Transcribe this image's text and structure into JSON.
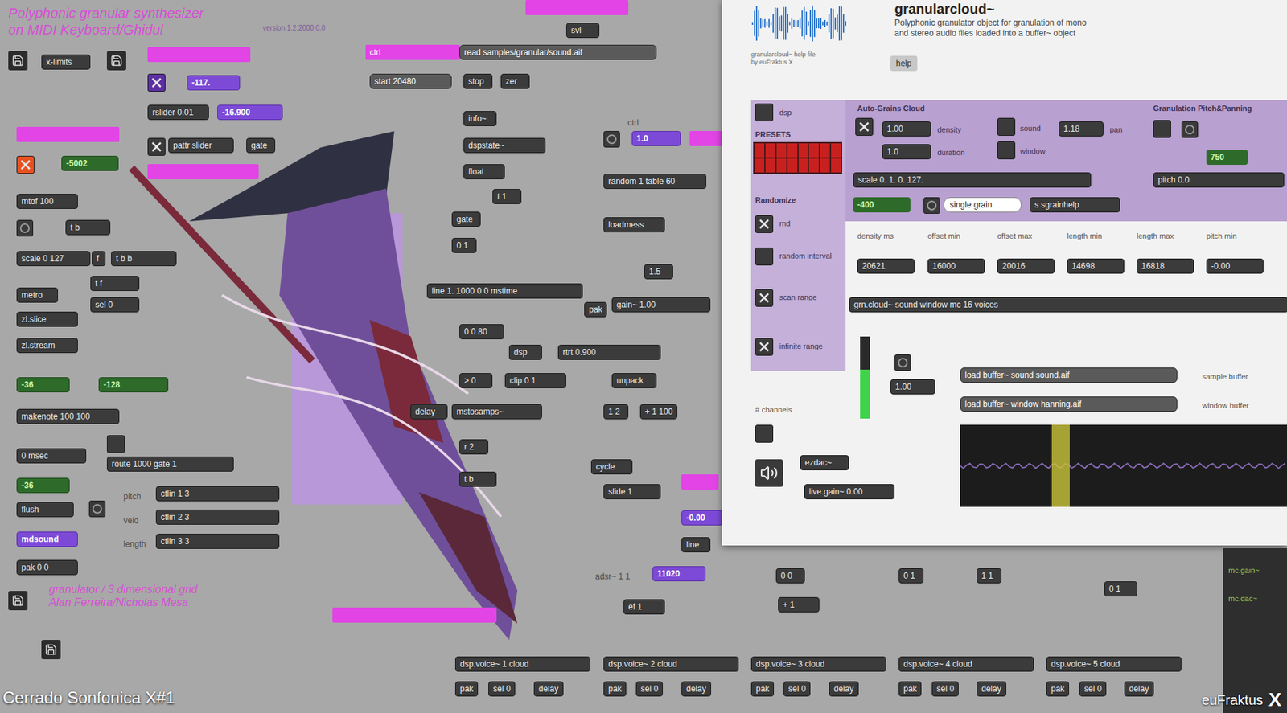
{
  "patch": {
    "title": [
      "Polyphonic granular synthesizer",
      "on MIDI Keyboard/Ghidul"
    ],
    "version": "version 1.2.2000.0.0",
    "footnote": [
      "granulator / 3 dimensional grid",
      "Alan Ferreira/Nicholas Mesa"
    ],
    "nodes": [
      {
        "kind": "object",
        "text": "x-limits"
      },
      {
        "kind": "pink",
        "text": ""
      },
      {
        "kind": "toggle",
        "checked": true,
        "color": "#5b2fa0"
      },
      {
        "kind": "purple",
        "text": "-117."
      },
      {
        "kind": "object",
        "text": "rslider 0.01"
      },
      {
        "kind": "purple",
        "text": "-16.900"
      },
      {
        "kind": "toggle",
        "checked": true,
        "color": "#3a3a3a"
      },
      {
        "kind": "object",
        "text": "pattr slider"
      },
      {
        "kind": "object",
        "text": "gate"
      },
      {
        "kind": "pink",
        "text": ""
      },
      {
        "kind": "pink",
        "text": ""
      },
      {
        "kind": "toggle",
        "checked": true,
        "color": "#e8501f"
      },
      {
        "kind": "number",
        "text": "-5002"
      },
      {
        "kind": "object",
        "text": "mtof 100"
      },
      {
        "kind": "button"
      },
      {
        "kind": "object",
        "text": "t b"
      },
      {
        "kind": "object",
        "text": "scale 0 127"
      },
      {
        "kind": "object",
        "text": "f"
      },
      {
        "kind": "object",
        "text": "t b b"
      },
      {
        "kind": "object",
        "text": "t f"
      },
      {
        "kind": "object",
        "text": "sel 0"
      },
      {
        "kind": "object",
        "text": "metro"
      },
      {
        "kind": "object",
        "text": "zl.slice"
      },
      {
        "kind": "object",
        "text": "zl.stream"
      },
      {
        "kind": "number",
        "text": "-36"
      },
      {
        "kind": "number",
        "text": "-128"
      },
      {
        "kind": "object",
        "text": "makenote 100 100"
      },
      {
        "kind": "toggle",
        "checked": false,
        "color": "#3a3a3a"
      },
      {
        "kind": "object",
        "text": "0 msec"
      },
      {
        "kind": "object",
        "text": "route 1000 gate 1"
      },
      {
        "kind": "number",
        "text": "-36"
      },
      {
        "kind": "object",
        "text": "flush"
      },
      {
        "kind": "button"
      },
      {
        "kind": "comment",
        "text": "pitch"
      },
      {
        "kind": "comment",
        "text": "velo"
      },
      {
        "kind": "comment",
        "text": "length"
      },
      {
        "kind": "object",
        "text": "ctlin 1 3"
      },
      {
        "kind": "object",
        "text": "ctlin 2 3"
      },
      {
        "kind": "object",
        "text": "ctlin 3 3"
      },
      {
        "kind": "purple",
        "text": "mdsound"
      },
      {
        "kind": "object",
        "text": "pak 0 0"
      },
      {
        "kind": "pink",
        "text": ""
      },
      {
        "kind": "pink",
        "text": ""
      },
      {
        "kind": "object",
        "text": "svl"
      },
      {
        "kind": "pink",
        "text": "ctrl"
      },
      {
        "kind": "message",
        "text": "read samples/granular/sound.aif"
      },
      {
        "kind": "message",
        "text": "start 20480"
      },
      {
        "kind": "object",
        "text": "stop"
      },
      {
        "kind": "object",
        "text": "zer"
      },
      {
        "kind": "object",
        "text": "info~"
      },
      {
        "kind": "object",
        "text": "dspstate~"
      },
      {
        "kind": "object",
        "text": "float"
      },
      {
        "kind": "object",
        "text": "t 1"
      },
      {
        "kind": "object",
        "text": "gate"
      },
      {
        "kind": "object",
        "text": "0 1"
      },
      {
        "kind": "comment",
        "text": "ctrl"
      },
      {
        "kind": "button"
      },
      {
        "kind": "purple",
        "text": "1.0"
      },
      {
        "kind": "pink",
        "text": ""
      },
      {
        "kind": "object",
        "text": "random 1 table 60"
      },
      {
        "kind": "object",
        "text": "loadmess"
      },
      {
        "kind": "object",
        "text": "1.5"
      },
      {
        "kind": "object",
        "text": "line 1. 1000 0 0 mstime"
      },
      {
        "kind": "object",
        "text": "pak"
      },
      {
        "kind": "object",
        "text": "gain~ 1.00"
      },
      {
        "kind": "object",
        "text": "0 0 80"
      },
      {
        "kind": "object",
        "text": "rtrt 0.900"
      },
      {
        "kind": "object",
        "text": "dsp"
      },
      {
        "kind": "object",
        "text": "> 0"
      },
      {
        "kind": "object",
        "text": "clip 0 1"
      },
      {
        "kind": "object",
        "text": "unpack"
      },
      {
        "kind": "object",
        "text": "delay"
      },
      {
        "kind": "object",
        "text": "mstosamps~"
      },
      {
        "kind": "object",
        "text": "1 2"
      },
      {
        "kind": "object",
        "text": "+ 1 100"
      },
      {
        "kind": "object",
        "text": "r 2"
      },
      {
        "kind": "object",
        "text": "t b"
      },
      {
        "kind": "object",
        "text": "cycle"
      },
      {
        "kind": "object",
        "text": "slide 1"
      },
      {
        "kind": "pink",
        "text": ""
      },
      {
        "kind": "purple",
        "text": "-0.00"
      },
      {
        "kind": "object",
        "text": "line"
      },
      {
        "kind": "comment",
        "text": "adsr~ 1 1"
      },
      {
        "kind": "purple",
        "text": "11020"
      },
      {
        "kind": "object",
        "text": "ef 1"
      },
      {
        "kind": "object",
        "text": "0 0"
      },
      {
        "kind": "object",
        "text": "0 1"
      },
      {
        "kind": "object",
        "text": "1 1"
      },
      {
        "kind": "object",
        "text": "+ 1"
      },
      {
        "kind": "object",
        "text": "0 1"
      }
    ],
    "voices": [
      {
        "top": "dsp.voice~ 1 cloud",
        "bottom": [
          "pak",
          "sel 0",
          "delay"
        ]
      },
      {
        "top": "dsp.voice~ 2 cloud",
        "bottom": [
          "pak",
          "sel 0",
          "delay"
        ]
      },
      {
        "top": "dsp.voice~ 3 cloud",
        "bottom": [
          "pak",
          "sel 0",
          "delay"
        ]
      },
      {
        "top": "dsp.voice~ 4 cloud",
        "bottom": [
          "pak",
          "sel 0",
          "delay"
        ]
      },
      {
        "top": "dsp.voice~ 5 cloud",
        "bottom": [
          "pak",
          "sel 0",
          "delay"
        ]
      }
    ]
  },
  "help_window": {
    "title": "granularcloud~",
    "description": [
      "Polyphonic granulator object for granulation of mono",
      "and stereo audio files loaded into a buffer~ object"
    ],
    "logo_caption": [
      "granularcloud~ help file",
      "by euFraktus X"
    ],
    "help_button": "help",
    "dsp": {
      "label": "dsp",
      "checked": false
    },
    "presets_label": "PRESETS",
    "presets": [
      {
        "stored": true
      },
      {
        "stored": true
      },
      {
        "stored": true
      },
      {
        "stored": true
      },
      {
        "stored": true
      },
      {
        "stored": true
      },
      {
        "stored": true
      },
      {
        "stored": true
      },
      {
        "stored": true
      },
      {
        "stored": true
      },
      {
        "stored": true
      },
      {
        "stored": true
      },
      {
        "stored": true
      },
      {
        "stored": true
      },
      {
        "stored": true
      },
      {
        "stored": true
      }
    ],
    "randomize_label": "Randomize",
    "randomize": [
      {
        "label": "rnd",
        "checked": true
      },
      {
        "label": "random interval",
        "checked": false
      },
      {
        "label": "scan range",
        "checked": true
      },
      {
        "label": "infinite range",
        "checked": true
      }
    ],
    "cloud": {
      "header": "Auto-Grains Cloud",
      "on": true,
      "values": [
        {
          "value": "1.00",
          "label": "density"
        },
        {
          "value": "1.0",
          "label": "duration"
        }
      ],
      "toggles": [
        {
          "label": "sound",
          "checked": false
        },
        {
          "label": "window",
          "checked": false
        }
      ],
      "pan": {
        "value": "1.18",
        "label": "pan"
      }
    },
    "pitch": {
      "header": "Granulation Pitch&Panning",
      "on": false,
      "value": "750",
      "object": "pitch 0.0"
    },
    "scale_object": "scale 0. 1. 0. 127.",
    "single": {
      "value": "-400",
      "message": "single grain",
      "object": "s sgrainhelp"
    },
    "params": [
      {
        "label": "density ms",
        "value": "20621"
      },
      {
        "label": "offset min",
        "value": "16000"
      },
      {
        "label": "offset max",
        "value": "20016"
      },
      {
        "label": "length min",
        "value": "14698"
      },
      {
        "label": "length max",
        "value": "16818"
      },
      {
        "label": "pitch min",
        "value": "-0.00"
      }
    ],
    "cloud_object": "grn.cloud~ sound window mc 16 voices",
    "meter": {
      "level": 0.6,
      "value": "1.00"
    },
    "buffers": [
      {
        "message": "load buffer~ sound sound.aif",
        "comment": "sample buffer"
      },
      {
        "message": "load buffer~ window hanning.aif",
        "comment": "window buffer"
      }
    ],
    "channels_label": "# channels",
    "channels_on": false,
    "dac": "ezdac~",
    "gain": "live.gain~ 0.00",
    "playhead": {
      "level": 0.28
    }
  },
  "strip_labels": [
    "mc.gain~",
    "mc.dac~"
  ],
  "caption": "Cerrado Sonfonica X#1",
  "watermark": "euFraktus",
  "watermark_mark": "X"
}
